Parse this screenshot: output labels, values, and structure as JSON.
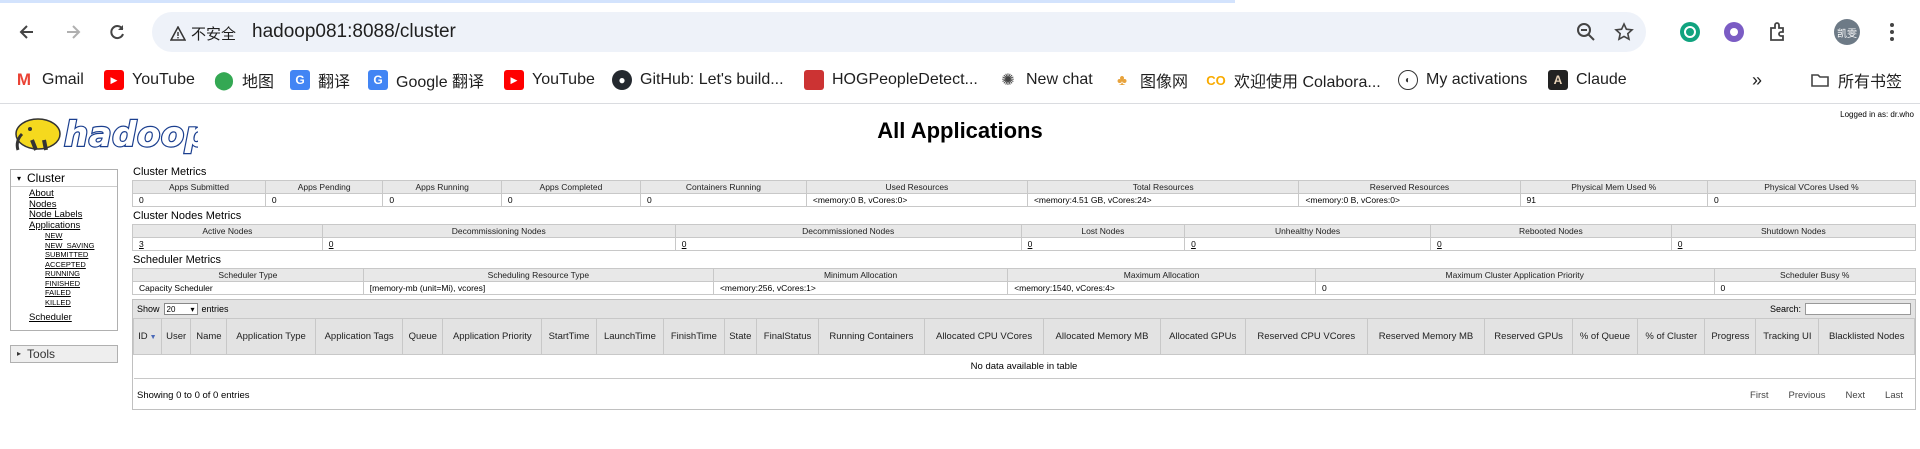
{
  "browser": {
    "security_label": "不安全",
    "url": "hadoop081:8088/cluster",
    "avatar_text": "凯雯",
    "bookmarks": [
      {
        "label": "Gmail",
        "icon": "gmail-icon",
        "color": "#ea4335"
      },
      {
        "label": "YouTube",
        "icon": "youtube-icon",
        "color": "#ff0000"
      },
      {
        "label": "地图",
        "icon": "maps-icon",
        "color": "#34a853"
      },
      {
        "label": "翻译",
        "icon": "translate-icon",
        "color": "#4285f4"
      },
      {
        "label": "Google 翻译",
        "icon": "translate-icon",
        "color": "#4285f4"
      },
      {
        "label": "YouTube",
        "icon": "youtube-icon",
        "color": "#ff0000"
      },
      {
        "label": "GitHub: Let's build...",
        "icon": "github-icon",
        "color": "#24292f"
      },
      {
        "label": "HOGPeopleDetect...",
        "icon": "hog-icon",
        "color": "#a33"
      },
      {
        "label": "New chat",
        "icon": "openai-icon",
        "color": "#444"
      },
      {
        "label": "图像网",
        "icon": "imagenet-icon",
        "color": "#e8a33c"
      },
      {
        "label": "欢迎使用 Colabora...",
        "icon": "colab-icon",
        "color": "#f9ab00"
      },
      {
        "label": "My activations",
        "icon": "activations-icon",
        "color": "#333"
      },
      {
        "label": "Claude",
        "icon": "claude-icon",
        "color": "#222"
      }
    ],
    "all_bookmarks_label": "所有书签"
  },
  "page": {
    "logged_in": "Logged in as: dr.who",
    "title": "All Applications",
    "logo_text": "hadoop"
  },
  "nav": {
    "cluster_label": "Cluster",
    "cluster_links": [
      "About",
      "Nodes",
      "Node Labels",
      "Applications"
    ],
    "app_states": [
      "NEW",
      "NEW_SAVING",
      "SUBMITTED",
      "ACCEPTED",
      "RUNNING",
      "FINISHED",
      "FAILED",
      "KILLED"
    ],
    "scheduler_link": "Scheduler",
    "tools_label": "Tools"
  },
  "cluster_metrics": {
    "title": "Cluster Metrics",
    "headers": [
      "Apps Submitted",
      "Apps Pending",
      "Apps Running",
      "Apps Completed",
      "Containers Running",
      "Used Resources",
      "Total Resources",
      "Reserved Resources",
      "Physical Mem Used %",
      "Physical VCores Used %"
    ],
    "values": [
      "0",
      "0",
      "0",
      "0",
      "0",
      "<memory:0 B, vCores:0>",
      "<memory:4.51 GB, vCores:24>",
      "<memory:0 B, vCores:0>",
      "91",
      "0"
    ]
  },
  "node_metrics": {
    "title": "Cluster Nodes Metrics",
    "headers": [
      "Active Nodes",
      "Decommissioning Nodes",
      "Decommissioned Nodes",
      "Lost Nodes",
      "Unhealthy Nodes",
      "Rebooted Nodes",
      "Shutdown Nodes"
    ],
    "values": [
      "3",
      "0",
      "0",
      "0",
      "0",
      "0",
      "0"
    ]
  },
  "scheduler_metrics": {
    "title": "Scheduler Metrics",
    "headers": [
      "Scheduler Type",
      "Scheduling Resource Type",
      "Minimum Allocation",
      "Maximum Allocation",
      "Maximum Cluster Application Priority",
      "Scheduler Busy %"
    ],
    "values": [
      "Capacity Scheduler",
      "[memory-mb (unit=Mi), vcores]",
      "<memory:256, vCores:1>",
      "<memory:1540, vCores:4>",
      "0",
      "0"
    ]
  },
  "apps_table": {
    "show_label": "Show",
    "entries_value": "20",
    "entries_label": "entries",
    "search_label": "Search:",
    "columns": [
      "ID",
      "User",
      "Name",
      "Application Type",
      "Application Tags",
      "Queue",
      "Application Priority",
      "StartTime",
      "LaunchTime",
      "FinishTime",
      "State",
      "FinalStatus",
      "Running Containers",
      "Allocated CPU VCores",
      "Allocated Memory MB",
      "Allocated GPUs",
      "Reserved CPU VCores",
      "Reserved Memory MB",
      "Reserved GPUs",
      "% of Queue",
      "% of Cluster",
      "Progress",
      "Tracking UI",
      "Blacklisted Nodes"
    ],
    "empty_text": "No data available in table",
    "info_text": "Showing 0 to 0 of 0 entries",
    "pager": [
      "First",
      "Previous",
      "Next",
      "Last"
    ]
  }
}
